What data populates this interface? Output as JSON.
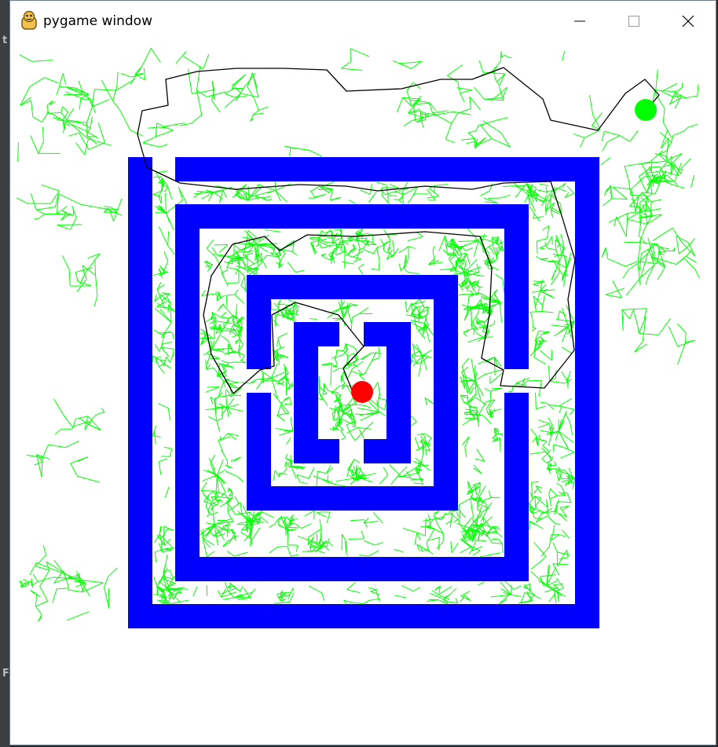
{
  "window": {
    "title": "pygame window",
    "buttons": [
      "minimize",
      "maximize",
      "close"
    ]
  },
  "background_app": {
    "visible_letters": [
      "t",
      "F"
    ]
  },
  "scene": {
    "description_items": [
      "maze",
      "rrt-tree",
      "path",
      "start-marker",
      "goal-marker"
    ],
    "colors": {
      "wall": "#0000ff",
      "tree": "#00ff00",
      "path": "#000000",
      "goal": "#00ff00",
      "start": "#ff0000"
    },
    "icons": [
      "pygame-icon",
      "minimize-icon",
      "maximize-icon",
      "close-icon"
    ]
  }
}
